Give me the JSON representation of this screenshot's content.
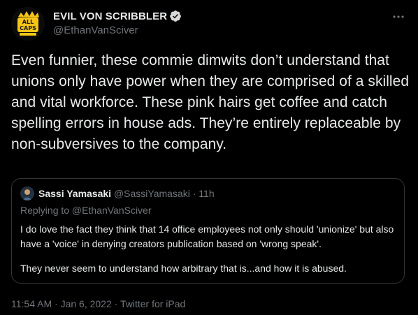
{
  "tweet": {
    "author": {
      "display_name": "EVIL VON SCRIBBLER",
      "handle": "@EthanVanSciver",
      "verified": true,
      "avatar_icon": "all-caps-comics-logo-icon",
      "avatar_logo_text": "ALL CAPS"
    },
    "more_icon": "more-options-icon",
    "text": "Even funnier, these commie dimwits don’t understand that unions only have power when they are comprised of a skilled and vital workforce. These pink hairs get coffee and catch spelling errors in house ads. They’re entirely replaceable by non-subversives to the company.",
    "quote": {
      "author": {
        "display_name": "Sassi Yamasaki",
        "handle": "@SassiYamasaki",
        "dot": "·",
        "time": "11h",
        "avatar_icon": "user-avatar-icon"
      },
      "replying_to": "Replying to @EthanVanSciver",
      "paragraph_1": "I do love the fact they think that 14 office employees not only should 'unionize' but also have a 'voice' in denying creators publication based on 'wrong speak'.",
      "paragraph_2": "They never seem to understand how arbitrary that is...and how it is abused."
    },
    "meta": {
      "time": "11:54 AM",
      "date": "Jan 6, 2022",
      "source": "Twitter for iPad",
      "separator": "·"
    }
  },
  "colors": {
    "background": "#000000",
    "text_primary": "#e7e9ea",
    "text_secondary": "#71767b",
    "border": "#333639",
    "verified_blue": "#1d9bf0",
    "logo_yellow": "#f5c518"
  }
}
